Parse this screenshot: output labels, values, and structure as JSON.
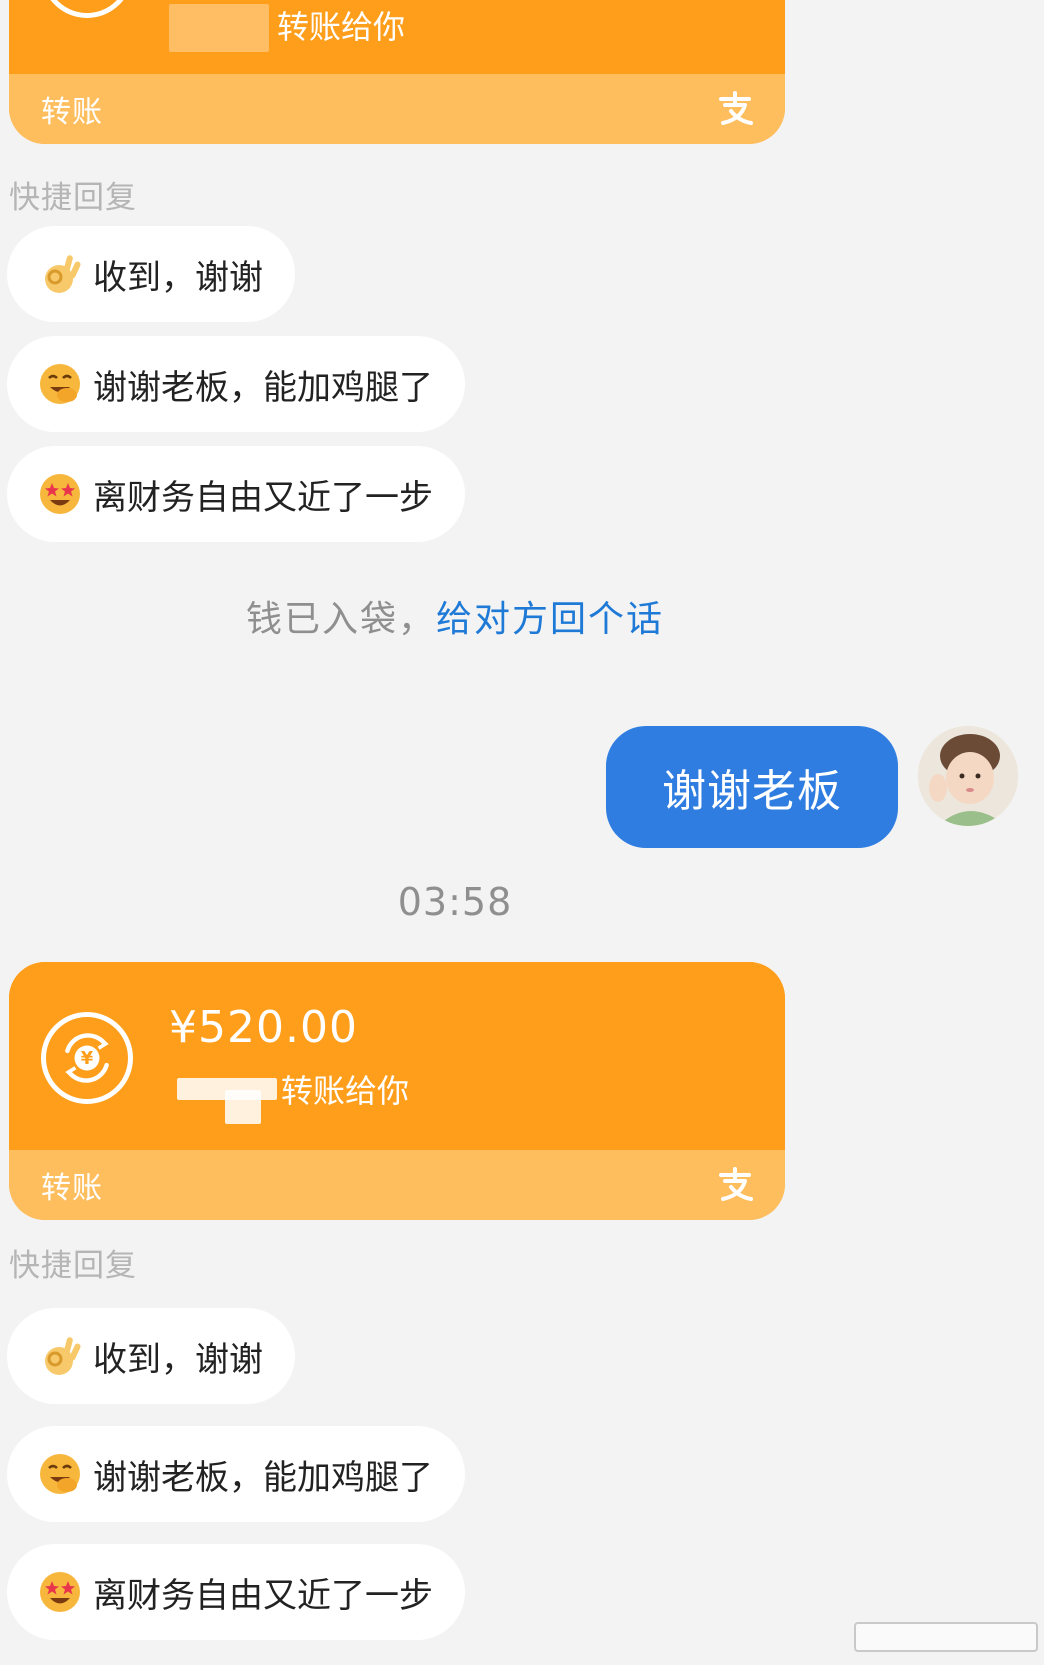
{
  "card1": {
    "sender_suffix": "转账给你",
    "footer_label": "转账"
  },
  "quick_reply_1": {
    "title": "快捷回复",
    "replies": [
      {
        "emoji": "ok-hand-emoji",
        "text": "收到，谢谢"
      },
      {
        "emoji": "grinning-hand-emoji",
        "text": "谢谢老板，能加鸡腿了"
      },
      {
        "emoji": "star-struck-emoji",
        "text": "离财务自由又近了一步"
      }
    ]
  },
  "notice": {
    "text": "钱已入袋，",
    "link": "给对方回个话"
  },
  "my_message": {
    "text": "谢谢老板"
  },
  "timestamp": "03:58",
  "card2": {
    "amount": "¥520.00",
    "sender_suffix": "转账给你",
    "footer_label": "转账"
  },
  "quick_reply_2": {
    "title": "快捷回复",
    "replies": [
      {
        "emoji": "ok-hand-emoji",
        "text": "收到，谢谢"
      },
      {
        "emoji": "grinning-hand-emoji",
        "text": "谢谢老板，能加鸡腿了"
      },
      {
        "emoji": "star-struck-emoji",
        "text": "离财务自由又近了一步"
      }
    ]
  },
  "colors": {
    "card_orange": "#ff9e1b",
    "card_footer": "#ffbe5e",
    "bubble_blue": "#2f7de1",
    "link_blue": "#1e7ad6"
  }
}
